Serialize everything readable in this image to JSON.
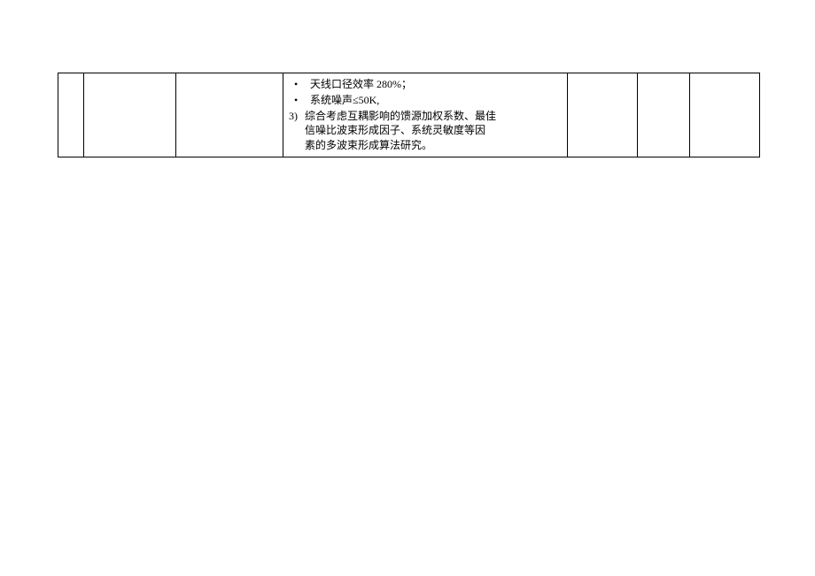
{
  "table": {
    "row": {
      "col1": "",
      "col2": "",
      "col3": "",
      "col4": {
        "bullets": [
          "天线口径效率 280%；",
          "系统噪声≤50K,"
        ],
        "numbered_label": "3)",
        "numbered_text_line1": "综合考虑互耦影响的馈源加权系数、最佳",
        "numbered_text_line2": "信噪比波束形成因子、系统灵敏度等因",
        "numbered_text_line3": "素的多波束形成算法研究。"
      },
      "col5": "",
      "col6": "",
      "col7": ""
    }
  }
}
